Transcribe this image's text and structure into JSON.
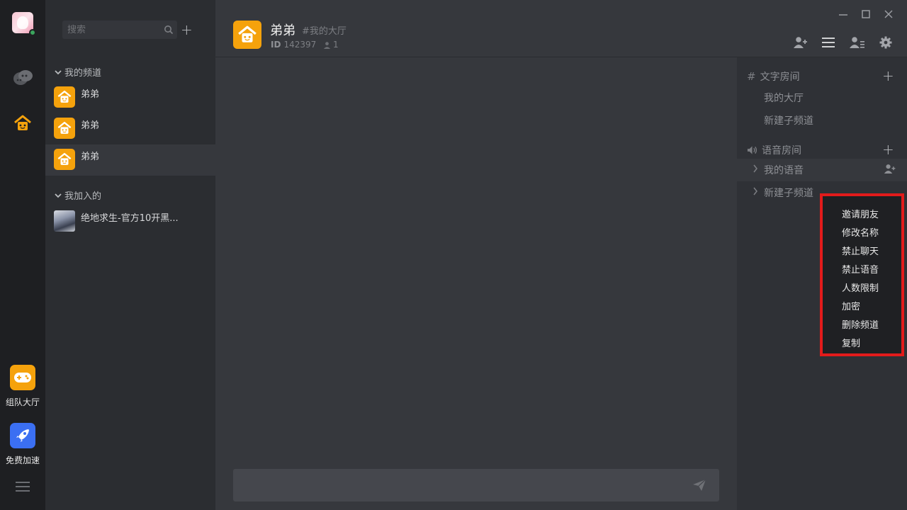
{
  "colors": {
    "accent_orange": "#f5a20c",
    "online": "#3ba55d",
    "highlight_border": "#e21b1b",
    "rocket_blue": "#3b6ff2"
  },
  "rail": {
    "apps": [
      {
        "label": "组队大厅",
        "icon": "gamepad-icon"
      },
      {
        "label": "免费加速",
        "icon": "rocket-icon"
      }
    ]
  },
  "sidebar": {
    "search_placeholder": "搜索",
    "my_channels_title": "我的频道",
    "my_channels": [
      {
        "name": "弟弟"
      },
      {
        "name": "弟弟"
      },
      {
        "name": "弟弟"
      }
    ],
    "joined_title": "我加入的",
    "joined": [
      {
        "name": "绝地求生-官方10开黑..."
      }
    ]
  },
  "header": {
    "title": "弟弟",
    "subtitle": "#我的大厅",
    "id_label": "ID",
    "id_value": "142397",
    "member_count": "1"
  },
  "right_panel": {
    "text_category": "文字房间",
    "text_rooms": [
      "我的大厅",
      "新建子频道"
    ],
    "voice_category": "语音房间",
    "voice_rooms": [
      "我的语音",
      "新建子频道"
    ]
  },
  "context_menu": {
    "items": [
      "邀请朋友",
      "修改名称",
      "禁止聊天",
      "禁止语音",
      "人数限制",
      "加密",
      "删除频道",
      "复制"
    ]
  }
}
